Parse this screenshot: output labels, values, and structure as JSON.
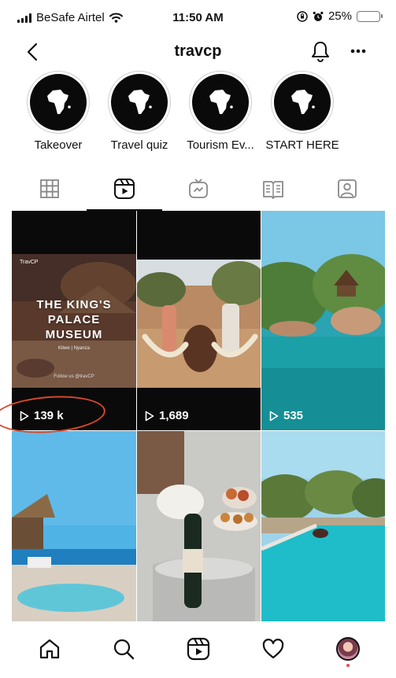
{
  "status_bar": {
    "carrier": "BeSafe Airtel",
    "time": "11:50 AM",
    "battery": "25%",
    "battery_level": 0.25,
    "battery_color": "#f5c518"
  },
  "header": {
    "username": "travcp",
    "back_icon": "chevron-left-icon",
    "bell_icon": "bell-icon",
    "more_icon": "more-horizontal-icon"
  },
  "highlights": [
    {
      "label": "Takeover",
      "icon": "africa-map-icon"
    },
    {
      "label": "Travel quiz",
      "icon": "africa-map-icon"
    },
    {
      "label": "Tourism Ev...",
      "icon": "africa-map-icon"
    },
    {
      "label": "START HERE",
      "icon": "africa-map-icon"
    }
  ],
  "tabs": [
    {
      "name": "grid",
      "icon": "grid-icon"
    },
    {
      "name": "reels",
      "icon": "reels-icon",
      "active": true
    },
    {
      "name": "igtv",
      "icon": "igtv-icon"
    },
    {
      "name": "guides",
      "icon": "guides-icon"
    },
    {
      "name": "tagged",
      "icon": "tagged-icon"
    }
  ],
  "reels": [
    {
      "views": "139 k",
      "overlay": {
        "brand": "TravCP",
        "title_line1": "THE KING'S",
        "title_line2": "PALACE",
        "title_line3": "MUSEUM",
        "subtitle": "Kitwe | Nyanza",
        "follow": "Follow us @travCP"
      }
    },
    {
      "views": "1,689"
    },
    {
      "views": "535"
    },
    {
      "views": ""
    },
    {
      "views": ""
    },
    {
      "views": ""
    }
  ],
  "bottom_nav": [
    {
      "name": "home",
      "icon": "home-icon"
    },
    {
      "name": "search",
      "icon": "search-icon"
    },
    {
      "name": "reels",
      "icon": "reels-icon"
    },
    {
      "name": "activity",
      "icon": "heart-icon"
    },
    {
      "name": "profile",
      "icon": "avatar"
    }
  ],
  "colors": {
    "annotation": "#d9472b",
    "notification_dot": "#ed4956"
  }
}
